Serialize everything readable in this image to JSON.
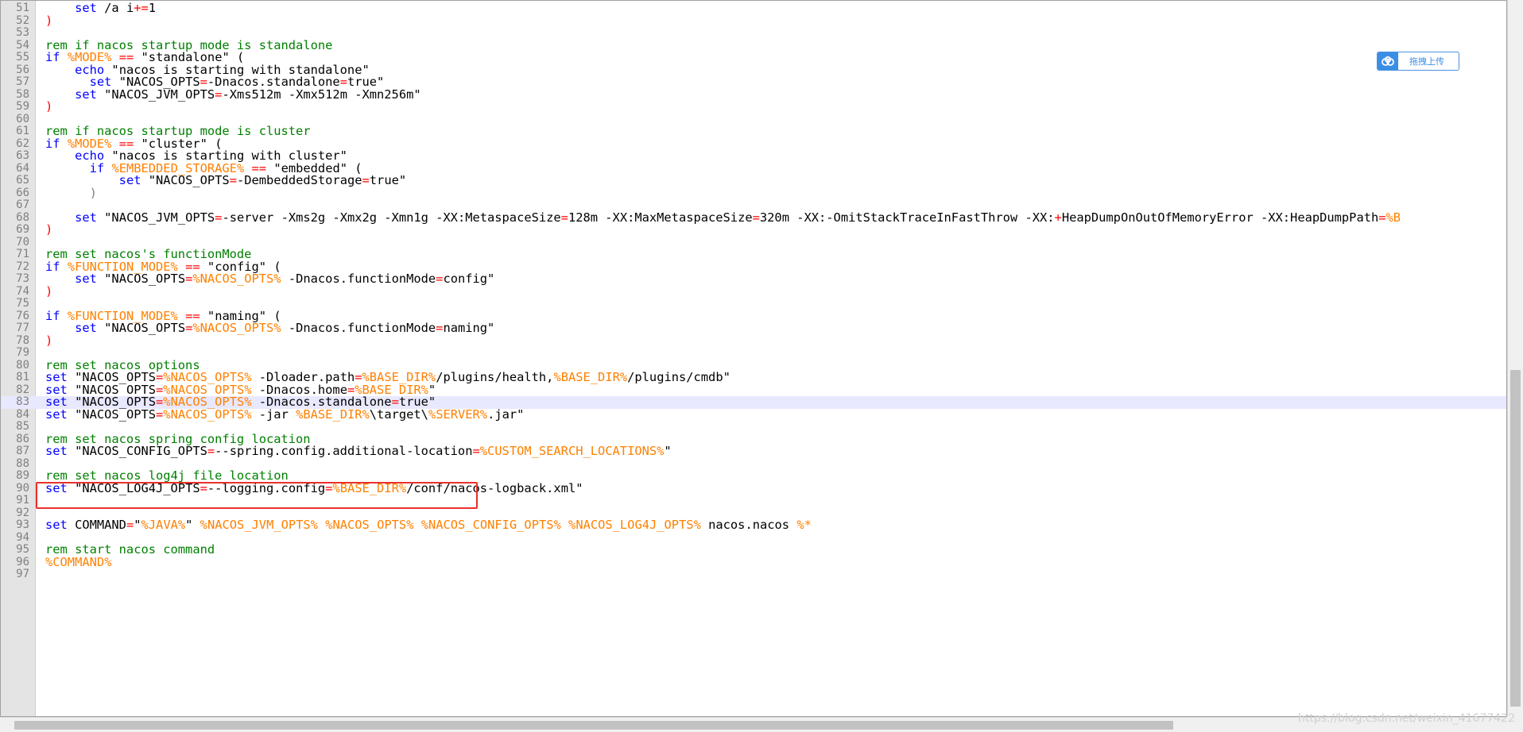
{
  "editor": {
    "lines": [
      {
        "num": "51",
        "tokens": [
          [
            "tx",
            "    "
          ],
          [
            "kw",
            "set"
          ],
          [
            "tx",
            " /a i"
          ],
          [
            "op",
            "+="
          ],
          [
            "tx",
            "1"
          ]
        ]
      },
      {
        "num": "52",
        "tokens": [
          [
            "op",
            ")"
          ]
        ]
      },
      {
        "num": "53",
        "tokens": []
      },
      {
        "num": "54",
        "tokens": [
          [
            "cm",
            "rem if nacos startup mode is standalone"
          ]
        ]
      },
      {
        "num": "55",
        "tokens": [
          [
            "kw",
            "if"
          ],
          [
            "tx",
            " "
          ],
          [
            "var",
            "%MODE%"
          ],
          [
            "tx",
            " "
          ],
          [
            "op",
            "=="
          ],
          [
            "tx",
            " \"standalone\" ("
          ]
        ]
      },
      {
        "num": "56",
        "tokens": [
          [
            "tx",
            "    "
          ],
          [
            "kw",
            "echo"
          ],
          [
            "tx",
            " \"nacos is starting with standalone\""
          ]
        ]
      },
      {
        "num": "57",
        "tokens": [
          [
            "tx",
            "      "
          ],
          [
            "kw",
            "set"
          ],
          [
            "tx",
            " \"NACOS_OPTS"
          ],
          [
            "op",
            "="
          ],
          [
            "tx",
            "-Dnacos.standalone"
          ],
          [
            "op",
            "="
          ],
          [
            "tx",
            "true\""
          ]
        ]
      },
      {
        "num": "58",
        "tokens": [
          [
            "tx",
            "    "
          ],
          [
            "kw",
            "set"
          ],
          [
            "tx",
            " \"NACOS_JVM_OPTS"
          ],
          [
            "op",
            "="
          ],
          [
            "tx",
            "-Xms512m -Xmx512m -Xmn256m\""
          ]
        ]
      },
      {
        "num": "59",
        "tokens": [
          [
            "op",
            ")"
          ]
        ]
      },
      {
        "num": "60",
        "tokens": []
      },
      {
        "num": "61",
        "tokens": [
          [
            "cm",
            "rem if nacos startup mode is cluster"
          ]
        ]
      },
      {
        "num": "62",
        "tokens": [
          [
            "kw",
            "if"
          ],
          [
            "tx",
            " "
          ],
          [
            "var",
            "%MODE%"
          ],
          [
            "tx",
            " "
          ],
          [
            "op",
            "=="
          ],
          [
            "tx",
            " \"cluster\" ("
          ]
        ]
      },
      {
        "num": "63",
        "tokens": [
          [
            "tx",
            "    "
          ],
          [
            "kw",
            "echo"
          ],
          [
            "tx",
            " \"nacos is starting with cluster\""
          ]
        ]
      },
      {
        "num": "64",
        "tokens": [
          [
            "tx",
            "      "
          ],
          [
            "kw",
            "if"
          ],
          [
            "tx",
            " "
          ],
          [
            "var",
            "%EMBEDDED_STORAGE%"
          ],
          [
            "tx",
            " "
          ],
          [
            "op",
            "=="
          ],
          [
            "tx",
            " \"embedded\" ("
          ]
        ]
      },
      {
        "num": "65",
        "tokens": [
          [
            "tx",
            "          "
          ],
          [
            "kw",
            "set"
          ],
          [
            "tx",
            " \"NACOS_OPTS"
          ],
          [
            "op",
            "="
          ],
          [
            "tx",
            "-DembeddedStorage"
          ],
          [
            "op",
            "="
          ],
          [
            "tx",
            "true\""
          ]
        ]
      },
      {
        "num": "66",
        "tokens": [
          [
            "tx",
            "      "
          ],
          [
            "str",
            ")"
          ]
        ]
      },
      {
        "num": "67",
        "tokens": []
      },
      {
        "num": "68",
        "tokens": [
          [
            "tx",
            "    "
          ],
          [
            "kw",
            "set"
          ],
          [
            "tx",
            " \"NACOS_JVM_OPTS"
          ],
          [
            "op",
            "="
          ],
          [
            "tx",
            "-server -Xms2g -Xmx2g -Xmn1g -XX:MetaspaceSize"
          ],
          [
            "op",
            "="
          ],
          [
            "tx",
            "128m -XX:MaxMetaspaceSize"
          ],
          [
            "op",
            "="
          ],
          [
            "tx",
            "320m -XX:-OmitStackTraceInFastThrow -XX:"
          ],
          [
            "op",
            "+"
          ],
          [
            "tx",
            "HeapDumpOnOutOfMemoryError -XX:HeapDumpPath"
          ],
          [
            "op",
            "="
          ],
          [
            "var",
            "%B"
          ]
        ]
      },
      {
        "num": "69",
        "tokens": [
          [
            "op",
            ")"
          ]
        ]
      },
      {
        "num": "70",
        "tokens": []
      },
      {
        "num": "71",
        "tokens": [
          [
            "cm",
            "rem set nacos's functionMode"
          ]
        ]
      },
      {
        "num": "72",
        "tokens": [
          [
            "kw",
            "if"
          ],
          [
            "tx",
            " "
          ],
          [
            "var",
            "%FUNCTION_MODE%"
          ],
          [
            "tx",
            " "
          ],
          [
            "op",
            "=="
          ],
          [
            "tx",
            " \"config\" ("
          ]
        ]
      },
      {
        "num": "73",
        "tokens": [
          [
            "tx",
            "    "
          ],
          [
            "kw",
            "set"
          ],
          [
            "tx",
            " \"NACOS_OPTS"
          ],
          [
            "op",
            "="
          ],
          [
            "var",
            "%NACOS_OPTS%"
          ],
          [
            "tx",
            " -Dnacos.functionMode"
          ],
          [
            "op",
            "="
          ],
          [
            "tx",
            "config\""
          ]
        ]
      },
      {
        "num": "74",
        "tokens": [
          [
            "op",
            ")"
          ]
        ]
      },
      {
        "num": "75",
        "tokens": []
      },
      {
        "num": "76",
        "tokens": [
          [
            "kw",
            "if"
          ],
          [
            "tx",
            " "
          ],
          [
            "var",
            "%FUNCTION_MODE%"
          ],
          [
            "tx",
            " "
          ],
          [
            "op",
            "=="
          ],
          [
            "tx",
            " \"naming\" ("
          ]
        ]
      },
      {
        "num": "77",
        "tokens": [
          [
            "tx",
            "    "
          ],
          [
            "kw",
            "set"
          ],
          [
            "tx",
            " \"NACOS_OPTS"
          ],
          [
            "op",
            "="
          ],
          [
            "var",
            "%NACOS_OPTS%"
          ],
          [
            "tx",
            " -Dnacos.functionMode"
          ],
          [
            "op",
            "="
          ],
          [
            "tx",
            "naming\""
          ]
        ]
      },
      {
        "num": "78",
        "tokens": [
          [
            "op",
            ")"
          ]
        ]
      },
      {
        "num": "79",
        "tokens": []
      },
      {
        "num": "80",
        "tokens": [
          [
            "cm",
            "rem set nacos options"
          ]
        ]
      },
      {
        "num": "81",
        "tokens": [
          [
            "kw",
            "set"
          ],
          [
            "tx",
            " \"NACOS_OPTS"
          ],
          [
            "op",
            "="
          ],
          [
            "var",
            "%NACOS_OPTS%"
          ],
          [
            "tx",
            " -Dloader.path"
          ],
          [
            "op",
            "="
          ],
          [
            "var",
            "%BASE_DIR%"
          ],
          [
            "tx",
            "/plugins/health,"
          ],
          [
            "var",
            "%BASE_DIR%"
          ],
          [
            "tx",
            "/plugins/cmdb\""
          ]
        ]
      },
      {
        "num": "82",
        "tokens": [
          [
            "kw",
            "set"
          ],
          [
            "tx",
            " \"NACOS_OPTS"
          ],
          [
            "op",
            "="
          ],
          [
            "var",
            "%NACOS_OPTS%"
          ],
          [
            "tx",
            " -Dnacos.home"
          ],
          [
            "op",
            "="
          ],
          [
            "var",
            "%BASE_DIR%"
          ],
          [
            "tx",
            "\""
          ]
        ]
      },
      {
        "num": "83",
        "current": true,
        "tokens": [
          [
            "kw",
            "set"
          ],
          [
            "tx",
            " \"NACOS_OPTS"
          ],
          [
            "op",
            "="
          ],
          [
            "var",
            "%NACOS_OPTS%"
          ],
          [
            "tx",
            " -Dnacos.standalone"
          ],
          [
            "op",
            "="
          ],
          [
            "tx",
            "true\""
          ]
        ]
      },
      {
        "num": "84",
        "tokens": [
          [
            "kw",
            "set"
          ],
          [
            "tx",
            " \"NACOS_OPTS"
          ],
          [
            "op",
            "="
          ],
          [
            "var",
            "%NACOS_OPTS%"
          ],
          [
            "tx",
            " -jar "
          ],
          [
            "var",
            "%BASE_DIR%"
          ],
          [
            "tx",
            "\\target\\"
          ],
          [
            "var",
            "%SERVER%"
          ],
          [
            "tx",
            ".jar\""
          ]
        ]
      },
      {
        "num": "85",
        "tokens": []
      },
      {
        "num": "86",
        "tokens": [
          [
            "cm",
            "rem set nacos spring config location"
          ]
        ]
      },
      {
        "num": "87",
        "tokens": [
          [
            "kw",
            "set"
          ],
          [
            "tx",
            " \"NACOS_CONFIG_OPTS"
          ],
          [
            "op",
            "="
          ],
          [
            "tx",
            "--spring.config.additional-location"
          ],
          [
            "op",
            "="
          ],
          [
            "var",
            "%CUSTOM_SEARCH_LOCATIONS%"
          ],
          [
            "tx",
            "\""
          ]
        ]
      },
      {
        "num": "88",
        "tokens": []
      },
      {
        "num": "89",
        "tokens": [
          [
            "cm",
            "rem set nacos log4j file location"
          ]
        ]
      },
      {
        "num": "90",
        "tokens": [
          [
            "kw",
            "set"
          ],
          [
            "tx",
            " \"NACOS_LOG4J_OPTS"
          ],
          [
            "op",
            "="
          ],
          [
            "tx",
            "--logging.config"
          ],
          [
            "op",
            "="
          ],
          [
            "var",
            "%BASE_DIR%"
          ],
          [
            "tx",
            "/conf/nacos-logback.xml\""
          ]
        ]
      },
      {
        "num": "91",
        "tokens": []
      },
      {
        "num": "92",
        "tokens": []
      },
      {
        "num": "93",
        "tokens": [
          [
            "kw",
            "set"
          ],
          [
            "tx",
            " COMMAND"
          ],
          [
            "op",
            "="
          ],
          [
            "tx",
            "\""
          ],
          [
            "var",
            "%JAVA%"
          ],
          [
            "tx",
            "\" "
          ],
          [
            "var",
            "%NACOS_JVM_OPTS%"
          ],
          [
            "tx",
            " "
          ],
          [
            "var",
            "%NACOS_OPTS%"
          ],
          [
            "tx",
            " "
          ],
          [
            "var",
            "%NACOS_CONFIG_OPTS%"
          ],
          [
            "tx",
            " "
          ],
          [
            "var",
            "%NACOS_LOG4J_OPTS%"
          ],
          [
            "tx",
            " nacos.nacos "
          ],
          [
            "var",
            "%*"
          ]
        ]
      },
      {
        "num": "94",
        "tokens": []
      },
      {
        "num": "95",
        "tokens": [
          [
            "cm",
            "rem start nacos command"
          ]
        ]
      },
      {
        "num": "96",
        "tokens": [
          [
            "var",
            "%COMMAND%"
          ]
        ]
      },
      {
        "num": "97",
        "tokens": []
      }
    ]
  },
  "upload_widget": {
    "label": "拖拽上传",
    "icon": "cloud-upload-icon"
  },
  "watermark": "https://blog.csdn.net/weixin_41677422",
  "colors": {
    "keyword": "#0000ff",
    "comment": "#008000",
    "operator": "#ff0000",
    "variable": "#ff8000",
    "text": "#000000",
    "current_line": "#e8e8ff",
    "highlight_box": "#e8312a"
  }
}
